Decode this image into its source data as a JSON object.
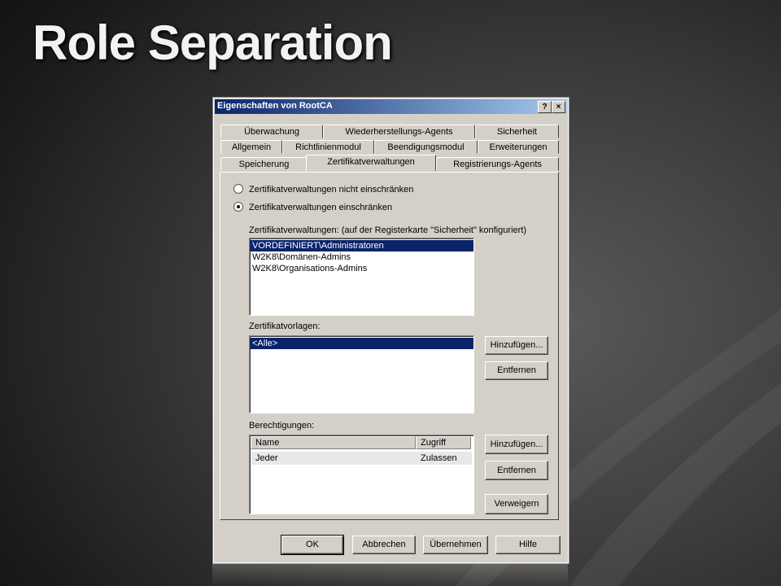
{
  "slide": {
    "title": "Role Separation"
  },
  "dialog": {
    "title": "Eigenschaften von RootCA",
    "help_button": "?",
    "close_button": "×",
    "tabs_row1": [
      "Überwachung",
      "Wiederherstellungs-Agents",
      "Sicherheit"
    ],
    "tabs_row2": [
      "Allgemein",
      "Richtlinienmodul",
      "Beendigungsmodul",
      "Erweiterungen"
    ],
    "tabs_row3": [
      "Speicherung",
      "Zertifikatverwaltungen",
      "Registrierungs-Agents"
    ],
    "active_tab": "Zertifikatverwaltungen",
    "radio_unrestricted": "Zertifikatverwaltungen nicht einschränken",
    "radio_restricted": "Zertifikatverwaltungen einschränken",
    "selected_radio": "restricted",
    "managers_label": "Zertifikatverwaltungen: (auf der Registerkarte \"Sicherheit\" konfiguriert)",
    "managers": [
      "VORDEFINIERT\\Administratoren",
      "W2K8\\Domänen-Admins",
      "W2K8\\Organisations-Admins"
    ],
    "templates_label": "Zertifikatvorlagen:",
    "templates": [
      "<Alle>"
    ],
    "add_button": "Hinzufügen...",
    "remove_button": "Entfernen",
    "permissions_label": "Berechtigungen:",
    "permissions_columns": [
      "Name",
      "Zugriff"
    ],
    "permissions_rows": [
      {
        "name": "Jeder",
        "access": "Zulassen"
      }
    ],
    "deny_button": "Verweigern",
    "ok_button": "OK",
    "cancel_button": "Abbrechen",
    "apply_button": "Übernehmen",
    "help_footer_button": "Hilfe"
  },
  "colors": {
    "selection": "#0a246a",
    "dialog_face": "#d4d0c8",
    "title_gradient_start": "#0a246a"
  }
}
